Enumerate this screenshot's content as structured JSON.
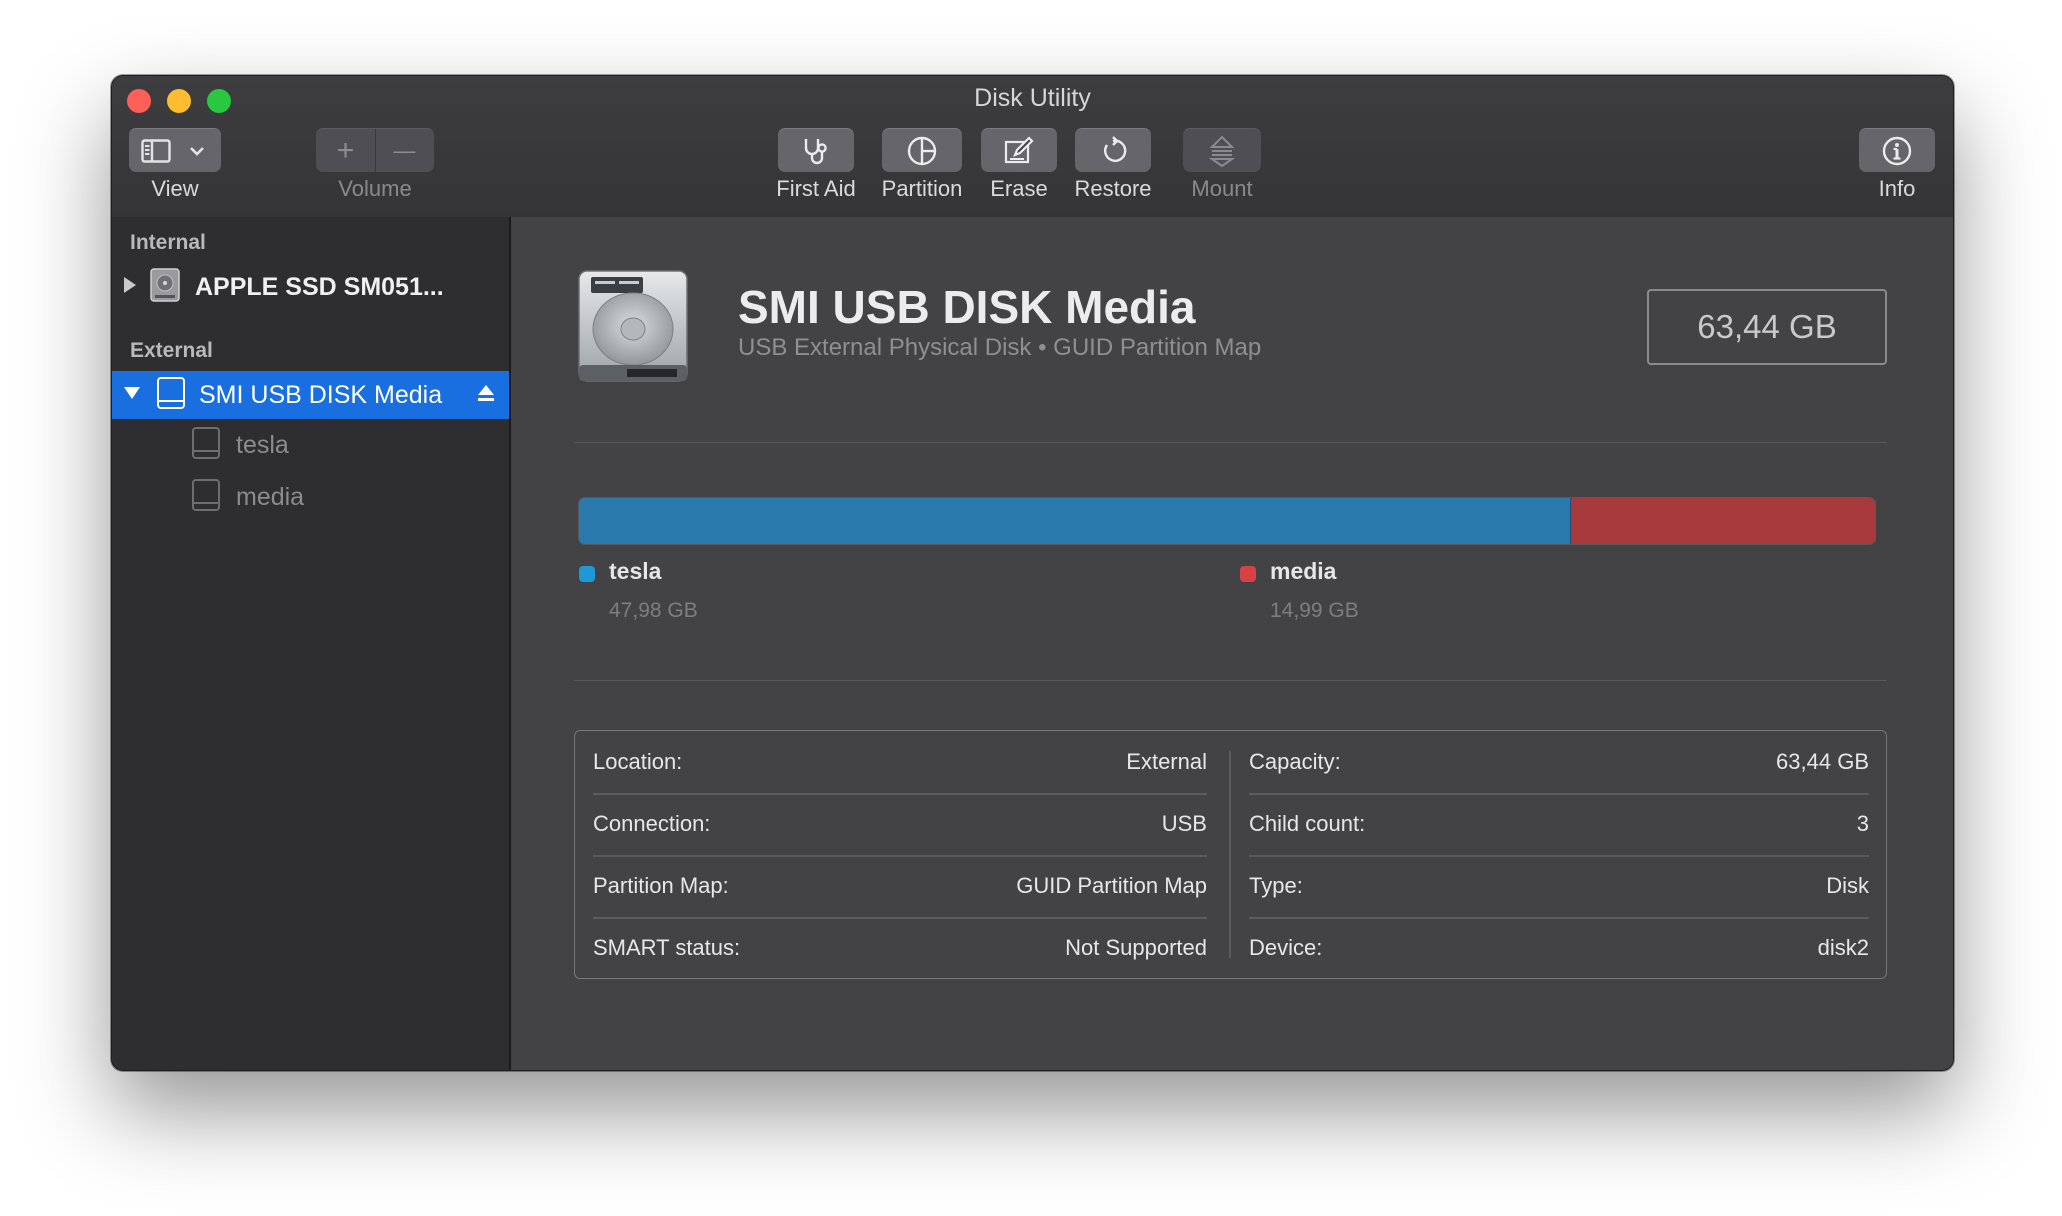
{
  "window": {
    "title": "Disk Utility"
  },
  "toolbar": {
    "view_label": "View",
    "volume_label": "Volume",
    "first_aid_label": "First Aid",
    "partition_label": "Partition",
    "erase_label": "Erase",
    "restore_label": "Restore",
    "mount_label": "Mount",
    "info_label": "Info",
    "add_glyph": "+",
    "remove_glyph": "—"
  },
  "sidebar": {
    "internal_header": "Internal",
    "internal_disk": "APPLE SSD SM051...",
    "external_header": "External",
    "external_disk": "SMI USB DISK Media",
    "volumes": [
      "tesla",
      "media"
    ]
  },
  "disk": {
    "name": "SMI USB DISK Media",
    "subtitle": "USB External Physical Disk • GUID Partition Map",
    "size": "63,44 GB"
  },
  "usage": {
    "partitions": [
      {
        "name": "tesla",
        "size": "47,98 GB",
        "fraction": 0.765,
        "color": "#2a7aae",
        "dot": "#1f98d6"
      },
      {
        "name": "media",
        "size": "14,99 GB",
        "fraction": 0.235,
        "color": "#a8393d",
        "dot": "#d84146"
      }
    ]
  },
  "info": {
    "left": [
      {
        "key": "Location:",
        "value": "External"
      },
      {
        "key": "Connection:",
        "value": "USB"
      },
      {
        "key": "Partition Map:",
        "value": "GUID Partition Map"
      },
      {
        "key": "SMART status:",
        "value": "Not Supported"
      }
    ],
    "right": [
      {
        "key": "Capacity:",
        "value": "63,44 GB"
      },
      {
        "key": "Child count:",
        "value": "3"
      },
      {
        "key": "Type:",
        "value": "Disk"
      },
      {
        "key": "Device:",
        "value": "disk2"
      }
    ]
  },
  "icons": [
    "sidebar-toggle-icon",
    "chevron-down-icon",
    "stethoscope-icon",
    "pie-chart-icon",
    "pencil-icon",
    "restore-icon",
    "mount-icon",
    "info-icon",
    "hard-drive-icon",
    "eject-icon",
    "disclosure-triangle-icon",
    "volume-icon"
  ]
}
